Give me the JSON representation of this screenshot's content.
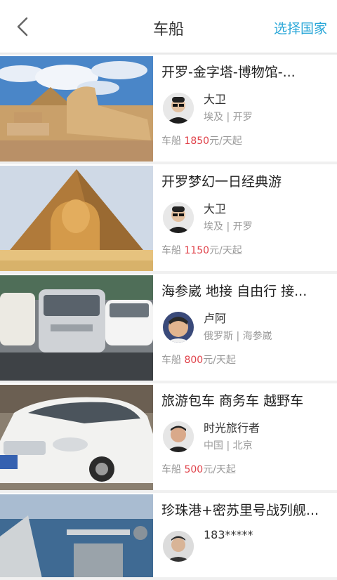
{
  "header": {
    "title": "车船",
    "right_label": "选择国家"
  },
  "items": [
    {
      "title": "开罗-金字塔-博物馆-...",
      "seller": "大卫",
      "location": "埃及 | 开罗",
      "price_prefix": "车船 ",
      "price": "1850",
      "price_suffix": "元/天起"
    },
    {
      "title": "开罗梦幻一日经典游",
      "seller": "大卫",
      "location": "埃及 | 开罗",
      "price_prefix": "车船 ",
      "price": "1150",
      "price_suffix": "元/天起"
    },
    {
      "title": "海参崴 地接 自由行 接...",
      "seller": "卢阿",
      "location": "俄罗斯 | 海参崴",
      "price_prefix": "车船 ",
      "price": "800",
      "price_suffix": "元/天起"
    },
    {
      "title": "旅游包车 商务车 越野车",
      "seller": "时光旅行者",
      "location": "中国 | 北京",
      "price_prefix": "车船 ",
      "price": "500",
      "price_suffix": "元/天起"
    },
    {
      "title": "珍珠港+密苏里号战列舰...",
      "seller": "183*****"
    }
  ]
}
